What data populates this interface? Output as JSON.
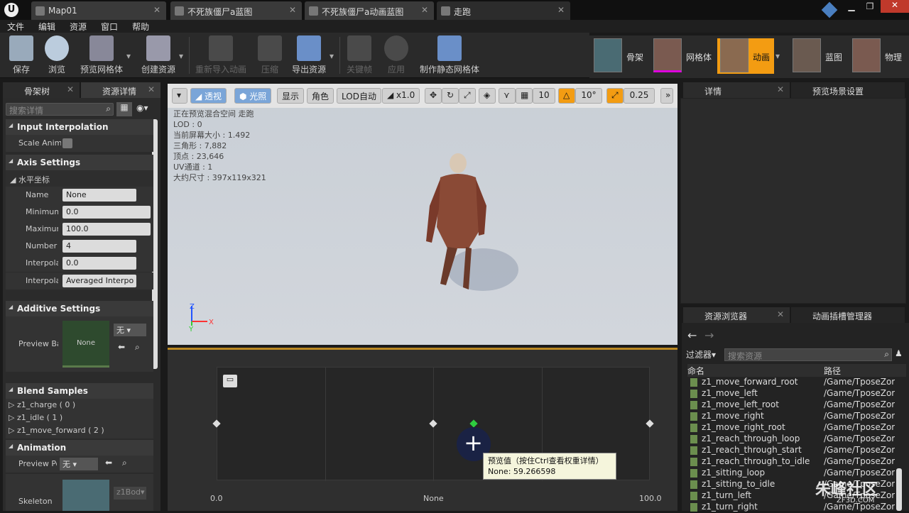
{
  "tabs": [
    {
      "label": "Map01"
    },
    {
      "label": "不死族僵尸a蓝图"
    },
    {
      "label": "不死族僵尸a动画蓝图"
    },
    {
      "label": "走跑"
    }
  ],
  "window": {
    "min": "▁",
    "max": "❐",
    "close": "✕"
  },
  "menu": [
    "文件",
    "编辑",
    "资源",
    "窗口",
    "帮助"
  ],
  "toolbar": {
    "save": "保存",
    "browse": "浏览",
    "preview_mesh": "预览网格体",
    "create_asset": "创建资源",
    "reimport": "重新导入动画",
    "compress": "压缩",
    "export": "导出资源",
    "keyframe": "关键帧",
    "apply": "应用",
    "make_static": "制作静态网格体"
  },
  "modes": [
    {
      "label": "骨架"
    },
    {
      "label": "网格体"
    },
    {
      "label": "动画"
    },
    {
      "label": "蓝图"
    },
    {
      "label": "物理"
    }
  ],
  "left": {
    "tab1": "骨架树",
    "tab2": "资源详情",
    "search_placeholder": "搜索详情",
    "sec_input": "Input Interpolation",
    "scale_anim": "Scale Anim",
    "sec_axis": "Axis Settings",
    "horizontal": "水平坐标",
    "name_lbl": "Name",
    "name_val": "None",
    "min_lbl": "Minimum",
    "min_val": "0.0",
    "max_lbl": "Maximum",
    "max_val": "100.0",
    "num_lbl": "Number of",
    "num_val": "4",
    "interp_lbl": "Interpola",
    "interp_val": "0.0",
    "interp2_lbl": "Interpola",
    "interp2_val": "Averaged Interpo",
    "sec_additive": "Additive Settings",
    "preview_base": "Preview Ba",
    "none_thumb": "None",
    "none_sel": "无",
    "sec_blend": "Blend Samples",
    "samples": [
      "z1_charge ( 0 )",
      "z1_idle ( 1 )",
      "z1_move_forward ( 2 )"
    ],
    "sec_anim": "Animation",
    "preview_pose": "Preview Po",
    "preview_pose_val": "无",
    "skeleton": "Skeleton",
    "skel_name": "z1Bod"
  },
  "viewport": {
    "perspective": "透视",
    "lit": "光照",
    "show": "显示",
    "character": "角色",
    "lod": "LOD自动",
    "speed": "x1.0",
    "grid": "10",
    "angle": "10°",
    "scale": "0.25",
    "stats": [
      "正在预览混合空间 走跑",
      "LOD : 0",
      "当前屏幕大小 : 1.492",
      "三角形 : 7,882",
      "顶点 : 23,646",
      "UV通道 : 1",
      "大约尺寸 : 397x119x321"
    ],
    "axis_z": "Z",
    "axis_x": "X",
    "axis_y": "Y"
  },
  "blendspace": {
    "min_label": "0.0",
    "mid_label": "None",
    "max_label": "100.0",
    "tooltip_title": "预览值（按住Ctrl查看权重详情）",
    "tooltip_value": "None: 59.266598",
    "sample_values": [
      0,
      50,
      100
    ],
    "preview_value": 59.266598
  },
  "right": {
    "tab_details": "详情",
    "tab_scene": "预览场景设置",
    "tab_browser": "资源浏览器",
    "tab_slot": "动画插槽管理器",
    "filter": "过滤器",
    "search_placeholder": "搜索资源",
    "col_name": "命名",
    "col_path": "路径",
    "assets": [
      {
        "name": "z1_move_forward_root",
        "path": "/Game/TposeZor"
      },
      {
        "name": "z1_move_left",
        "path": "/Game/TposeZor"
      },
      {
        "name": "z1_move_left_root",
        "path": "/Game/TposeZor"
      },
      {
        "name": "z1_move_right",
        "path": "/Game/TposeZor"
      },
      {
        "name": "z1_move_right_root",
        "path": "/Game/TposeZor"
      },
      {
        "name": "z1_reach_through_loop",
        "path": "/Game/TposeZor"
      },
      {
        "name": "z1_reach_through_start",
        "path": "/Game/TposeZor"
      },
      {
        "name": "z1_reach_through_to_idle",
        "path": "/Game/TposeZor"
      },
      {
        "name": "z1_sitting_loop",
        "path": "/Game/TposeZor"
      },
      {
        "name": "z1_sitting_to_idle",
        "path": "/Game/TposeZor"
      },
      {
        "name": "z1_turn_left",
        "path": "/Game/TposeZor"
      },
      {
        "name": "z1_turn_right",
        "path": "/Game/TposeZor"
      }
    ]
  },
  "watermark": "朱峰社区",
  "watermark_sub": "ZF3D.COM"
}
